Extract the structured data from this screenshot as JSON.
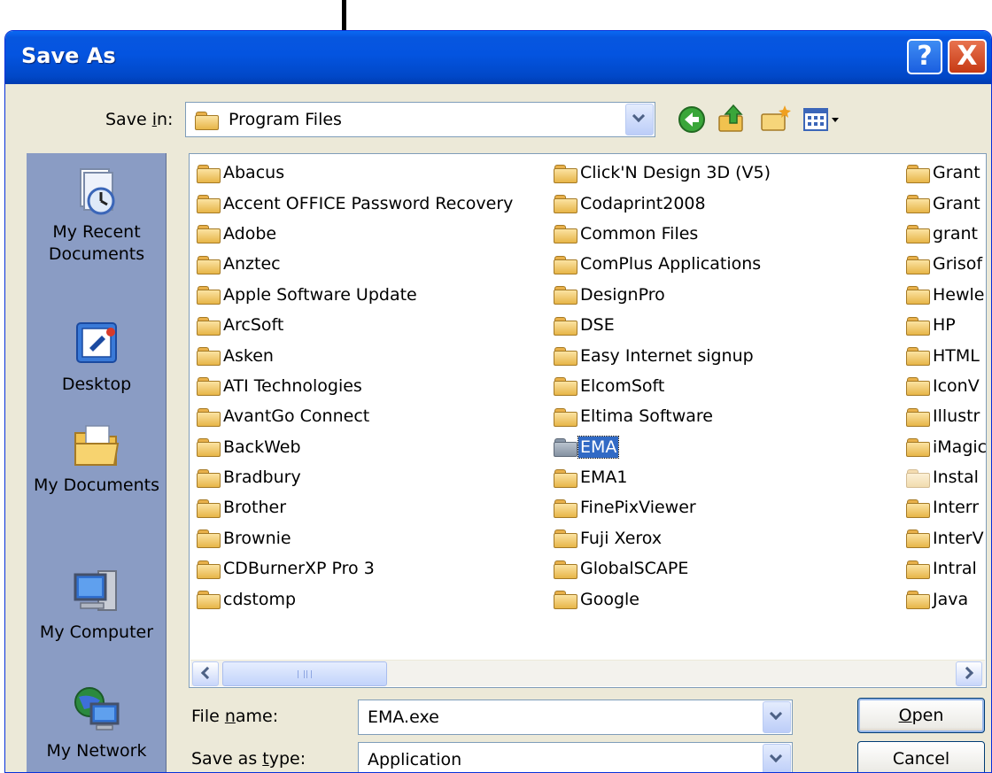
{
  "window": {
    "title": "Save As",
    "help_glyph": "?",
    "close_glyph": "X"
  },
  "save_in": {
    "label_pre": "Save ",
    "label_mnemonic": "i",
    "label_post": "n:",
    "value": "Program Files"
  },
  "places": [
    {
      "label_line1": "My Recent",
      "label_line2": "Documents",
      "icon": "recent-documents-icon"
    },
    {
      "label_line1": "Desktop",
      "label_line2": "",
      "icon": "desktop-icon"
    },
    {
      "label_line1": "My Documents",
      "label_line2": "",
      "icon": "my-documents-icon"
    },
    {
      "label_line1": "My Computer",
      "label_line2": "",
      "icon": "my-computer-icon"
    },
    {
      "label_line1": "My Network",
      "label_line2": "",
      "icon": "my-network-icon"
    }
  ],
  "files": {
    "column1": [
      "Abacus",
      "Accent OFFICE Password Recovery",
      "Adobe",
      "Anztec",
      "Apple Software Update",
      "ArcSoft",
      "Asken",
      "ATI Technologies",
      "AvantGo Connect",
      "BackWeb",
      "Bradbury",
      "Brother",
      "Brownie",
      "CDBurnerXP Pro 3",
      "cdstomp"
    ],
    "column2": [
      "Click'N Design 3D (V5)",
      "Codaprint2008",
      "Common Files",
      "ComPlus Applications",
      "DesignPro",
      "DSE",
      "Easy Internet signup",
      "ElcomSoft",
      "Eltima Software",
      "EMA",
      "EMA1",
      "FinePixViewer",
      "Fuji Xerox",
      "GlobalSCAPE",
      "Google"
    ],
    "column3": [
      "Grant",
      "Grant",
      "grant",
      "Grisof",
      "Hewle",
      "HP",
      "HTML",
      "IconV",
      "Illustr",
      "iMagic",
      "Instal",
      "Interr",
      "InterV",
      "Intral",
      "Java"
    ],
    "selected": "EMA",
    "scroll_grip": "III"
  },
  "file_name": {
    "label_pre": "File ",
    "label_mnemonic": "n",
    "label_post": "ame:",
    "value": "EMA.exe"
  },
  "save_type": {
    "label_pre": "Save as ",
    "label_mnemonic": "t",
    "label_post": "ype:",
    "value": "Application"
  },
  "buttons": {
    "open_mnemonic": "O",
    "open_rest": "pen",
    "cancel": "Cancel"
  },
  "colors": {
    "titlebar": "#0454e0",
    "dialog_bg": "#ece9d8",
    "selection": "#316ac5",
    "places_bar": "#8a9cc4"
  }
}
